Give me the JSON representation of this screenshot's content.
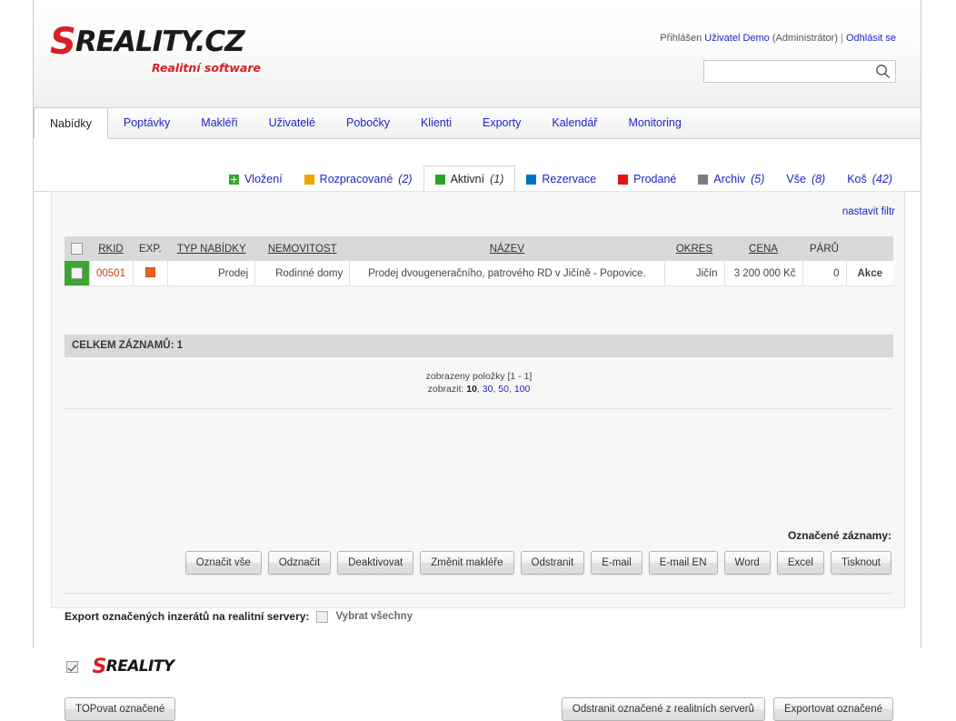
{
  "header": {
    "logo_main_s": "S",
    "logo_main_rest": "REALITY.CZ",
    "logo_sub": "Realitní software",
    "login_prefix": "Přihlášen",
    "login_user": "Uživatel Demo",
    "login_role": "(Administrátor)",
    "login_separator": "|",
    "logout_label": "Odhlásit se",
    "search_value": "",
    "search_placeholder": "",
    "search_icon": "search-icon"
  },
  "mainnav": {
    "tabs": [
      {
        "label": "Nabídky",
        "active": true
      },
      {
        "label": "Poptávky",
        "active": false
      },
      {
        "label": "Makléři",
        "active": false
      },
      {
        "label": "Uživatelé",
        "active": false
      },
      {
        "label": "Pobočky",
        "active": false
      },
      {
        "label": "Klienti",
        "active": false
      },
      {
        "label": "Exporty",
        "active": false
      },
      {
        "label": "Kalendář",
        "active": false
      },
      {
        "label": "Monitoring",
        "active": false
      }
    ]
  },
  "subtabs": [
    {
      "label": "Vložení",
      "count": "",
      "color": "#3aa533",
      "kind": "plus",
      "active": false
    },
    {
      "label": "Rozpracované",
      "count": "(2)",
      "color": "#f5a300",
      "kind": "square",
      "active": false
    },
    {
      "label": "Aktivní",
      "count": "(1)",
      "color": "#2aa32a",
      "kind": "square",
      "active": true
    },
    {
      "label": "Rezervace",
      "count": "",
      "color": "#0073c8",
      "kind": "square",
      "active": false
    },
    {
      "label": "Prodané",
      "count": "",
      "color": "#e21616",
      "kind": "square",
      "active": false
    },
    {
      "label": "Archiv",
      "count": "(5)",
      "color": "#7d7d7d",
      "kind": "square",
      "active": false
    },
    {
      "label": "Vše",
      "count": "(8)",
      "color": "",
      "kind": "none",
      "active": false
    },
    {
      "label": "Koš",
      "count": "(42)",
      "color": "",
      "kind": "none",
      "active": false
    }
  ],
  "filter": {
    "link_label": "nastavit filtr"
  },
  "table": {
    "headers": [
      {
        "label": "",
        "key": "checkbox"
      },
      {
        "label": "RKID",
        "underline": true
      },
      {
        "label": "EXP.",
        "underline": false
      },
      {
        "label": "TYP NABÍDKY",
        "underline": true
      },
      {
        "label": "NEMOVITOST",
        "underline": true
      },
      {
        "label": "NÁZEV",
        "underline": true
      },
      {
        "label": "OKRES",
        "underline": true
      },
      {
        "label": "CENA",
        "underline": true
      },
      {
        "label": "PÁRŮ",
        "underline": false
      },
      {
        "label": "",
        "key": "action"
      }
    ],
    "rows": [
      {
        "rkid": "00501",
        "exp_color": "#f06422",
        "typ": "Prodej",
        "nemovitost": "Rodinné domy",
        "nazev": "Prodej dvougeneračního, patrového RD v Jičíně - Popovice.",
        "okres": "Jičín",
        "cena": "3 200 000 Kč",
        "paru": "0",
        "akce": "Akce",
        "status_color": "#3aa533"
      }
    ],
    "total_label": "CELKEM ZÁZNAMŮ: 1"
  },
  "pager": {
    "shown_label": "zobrazeny položky [1 - 1]",
    "display_label": "zobrazit:",
    "options": [
      "10",
      "30",
      "50",
      "100"
    ],
    "selected": "10"
  },
  "actions": {
    "marked_label": "Označené záznamy:",
    "buttons": [
      "Označit vše",
      "Odznačit",
      "Deaktivovat",
      "Změnit makléře",
      "Odstranit",
      "E-mail",
      "E-mail EN",
      "Word",
      "Excel",
      "Tisknout"
    ]
  },
  "export": {
    "title": "Export označených inzerátů na realitní servery:",
    "select_all_label": "Vybrat všechny",
    "select_all_checked": false,
    "servers": [
      {
        "name": "SREALITY",
        "logo_s": "S",
        "logo_rest": "REALITY",
        "checked": true
      }
    ]
  },
  "bottom": {
    "top_button": "TOPovat označené",
    "remove_button": "Odstranit označené z realitních serverů",
    "export_button": "Exportovat označené"
  }
}
